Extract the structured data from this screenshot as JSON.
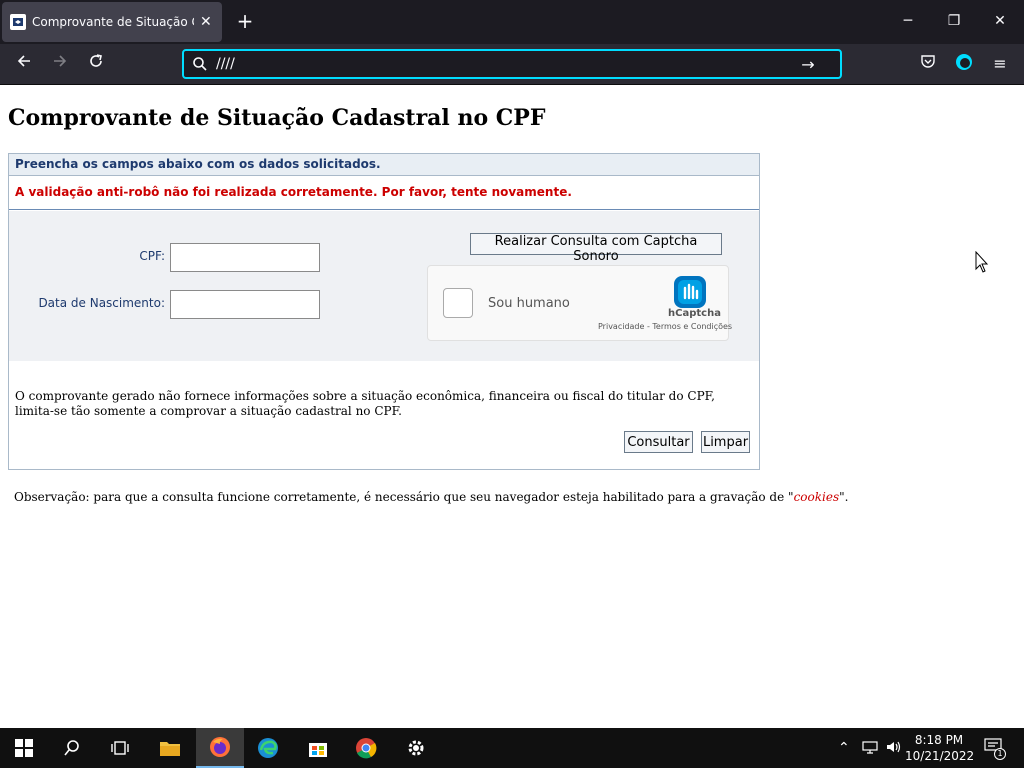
{
  "browser": {
    "tab_title": "Comprovante de Situação Cada",
    "new_tab_icon": "plus-icon",
    "url_value": "////",
    "window_controls": [
      "minimize",
      "maximize",
      "close"
    ],
    "accent": "#00ddff"
  },
  "page": {
    "title": "Comprovante de Situação Cadastral no CPF",
    "instruction": "Preencha os campos abaixo com os dados solicitados.",
    "error": "A validação anti-robô não foi realizada corretamente. Por favor, tente novamente.",
    "error_color": "#cc0000",
    "fields": {
      "cpf_label": "CPF:",
      "cpf_value": "",
      "birth_label": "Data de Nascimento:",
      "birth_value": ""
    },
    "audio_captcha_button": "Realizar Consulta com Captcha Sonoro",
    "captcha": {
      "label": "Sou humano",
      "brand": "hCaptcha",
      "links": "Privacidade - Termos e Condições"
    },
    "disclaimer": "O comprovante gerado não fornece informações sobre a situação econômica, financeira ou fiscal do titular do CPF, limita-se tão somente a comprovar a situação cadastral no CPF.",
    "buttons": {
      "consultar": "Consultar",
      "limpar": "Limpar"
    },
    "observation_prefix": "Observação: para que a consulta funcione corretamente, é necessário que seu navegador esteja habilitado para a gravação de \"",
    "observation_cookies": "cookies",
    "observation_suffix": "\"."
  },
  "taskbar": {
    "time": "8:18 PM",
    "date": "10/21/2022",
    "notification_count": "1"
  }
}
